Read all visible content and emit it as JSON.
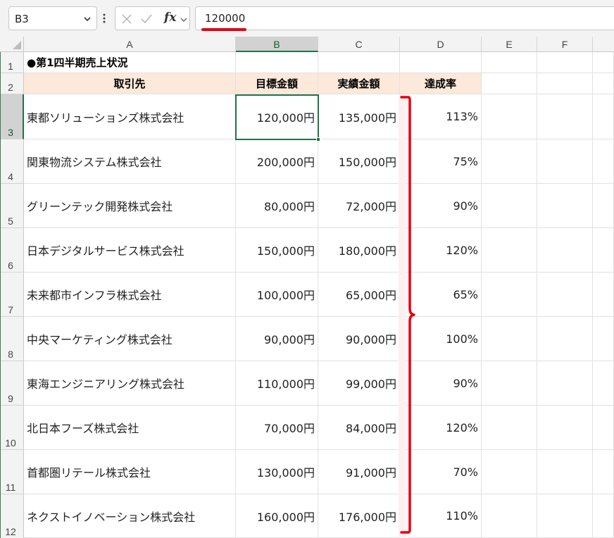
{
  "formula_bar": {
    "name_box": "B3",
    "cancel_icon": "close-icon",
    "enter_icon": "check-icon",
    "fx_label": "fx",
    "formula_value": "120000"
  },
  "columns": [
    "A",
    "B",
    "C",
    "D",
    "E",
    "F"
  ],
  "selected_column": "B",
  "selected_row": "3",
  "rows": [
    "1",
    "2",
    "3",
    "4",
    "5",
    "6",
    "7",
    "8",
    "9",
    "10",
    "11",
    "12"
  ],
  "sheet": {
    "title": "●第1四半期売上状況",
    "headers": [
      "取引先",
      "目標金額",
      "実績金額",
      "達成率"
    ],
    "data": [
      [
        "東都ソリューションズ株式会社",
        "120,000円",
        "135,000円",
        "113%"
      ],
      [
        "関東物流システム株式会社",
        "200,000円",
        "150,000円",
        "75%"
      ],
      [
        "グリーンテック開発株式会社",
        "80,000円",
        "72,000円",
        "90%"
      ],
      [
        "日本デジタルサービス株式会社",
        "150,000円",
        "180,000円",
        "120%"
      ],
      [
        "未来都市インフラ株式会社",
        "100,000円",
        "65,000円",
        "65%"
      ],
      [
        "中央マーケティング株式会社",
        "90,000円",
        "90,000円",
        "100%"
      ],
      [
        "東海エンジニアリング株式会社",
        "110,000円",
        "99,000円",
        "90%"
      ],
      [
        "北日本フーズ株式会社",
        "70,000円",
        "84,000円",
        "120%"
      ],
      [
        "首都圏リテール株式会社",
        "130,000円",
        "91,000円",
        "70%"
      ],
      [
        "ネクストイノベーション株式会社",
        "160,000円",
        "176,000円",
        "110%"
      ]
    ]
  },
  "colors": {
    "header_fill": "#fde9d9",
    "selection_green": "#217346",
    "annotation_red": "#e60012"
  }
}
